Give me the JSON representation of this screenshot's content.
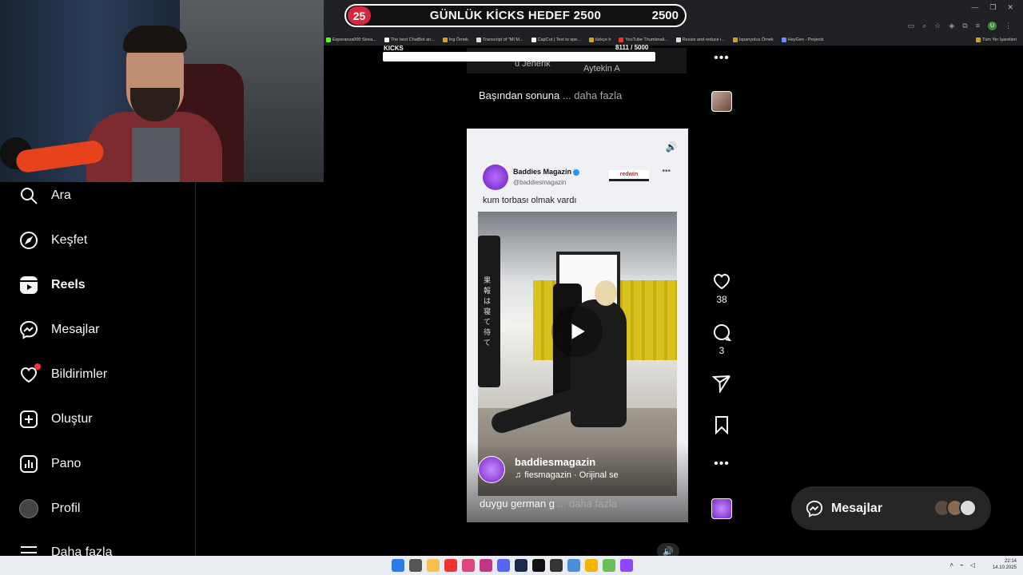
{
  "stream_overlay": {
    "goal_badge": "25",
    "goal_title": "GÜNLÜK KİCKS HEDEF 2500",
    "goal_value": "2500",
    "kicks_label": "KICKS",
    "kicks_count": "8111 / 5000",
    "kicks_progress": 1.0
  },
  "browser": {
    "bookmarks": [
      "Esperanza000 Strea...",
      "The best ChatBot an...",
      "İng Örnek",
      "Transcript of \"MI M...",
      "CapCut | Text to spe...",
      "türkçe h",
      "YouTube Thumbnail...",
      "Resize and reduce i...",
      "İspanyolca Örnek",
      "HeyGen - Projects"
    ],
    "bookmarks_right": "Tüm Yer İşaretleri",
    "profile_initial": "U"
  },
  "sidebar": {
    "items": [
      {
        "label": "Ara",
        "icon": "search-icon"
      },
      {
        "label": "Keşfet",
        "icon": "compass-icon"
      },
      {
        "label": "Reels",
        "icon": "reels-icon"
      },
      {
        "label": "Mesajlar",
        "icon": "messenger-icon"
      },
      {
        "label": "Bildirimler",
        "icon": "heart-icon"
      },
      {
        "label": "Oluştur",
        "icon": "plus-square-icon"
      },
      {
        "label": "Pano",
        "icon": "dashboard-icon"
      },
      {
        "label": "Profil",
        "icon": "avatar"
      },
      {
        "label": "Daha fazla",
        "icon": "menu-icon"
      }
    ]
  },
  "previous_reel": {
    "text_left": "u Jenerik",
    "text_right": "Aytekin A",
    "caption": "Başından sonuna",
    "more": "... daha fazla"
  },
  "reel": {
    "tweet_name": "Baddies Magazin",
    "tweet_handle": "@baddiesmagazin",
    "tweet_sponsor": "redwin",
    "tweet_text": "kum torbası olmak vardı",
    "bag_text": "果報は寝て待て",
    "owner": "baddiesmagazin",
    "audio": "fiesmagazin · Orijinal se",
    "caption": "duygu german g",
    "more": "... daha fazla"
  },
  "actions": {
    "likes": "38",
    "comments": "3"
  },
  "messages_dock": {
    "label": "Mesajlar"
  },
  "taskbar": {
    "time": "22:14",
    "date": "14.10.2025"
  },
  "colors": {
    "background": "#000000",
    "goal_badge": "#d7263d",
    "notification_dot": "#ff3040",
    "dock": "#262626"
  }
}
